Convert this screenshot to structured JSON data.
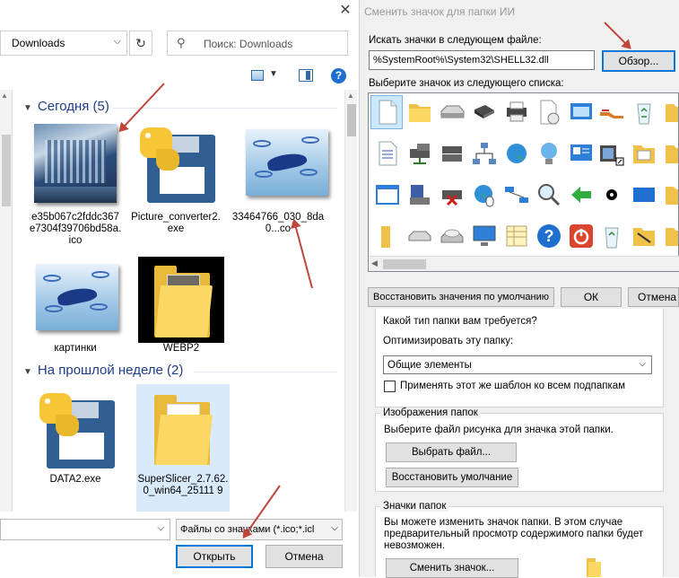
{
  "file_dialog": {
    "address": "Downloads",
    "search_placeholder": "Поиск: Downloads",
    "groups": [
      {
        "label": "Сегодня (5)"
      },
      {
        "label": "На прошлой неделе (2)"
      }
    ],
    "files": [
      {
        "name": "e35b067c2fddc367e7304f39706bd58a.ico"
      },
      {
        "name": "Picture_converter2.exe"
      },
      {
        "name": "33464766_030_8da0...co"
      },
      {
        "name": "картинки"
      },
      {
        "name": "WEBP2"
      },
      {
        "name": "DATA2.exe"
      },
      {
        "name": "SuperSlicer_2.7.62.0_win64_25111 9"
      }
    ],
    "filter": "Файлы со значками (*.ico;*.icl",
    "open_label": "Открыть",
    "cancel_label": "Отмена"
  },
  "icon_dialog": {
    "title": "Сменить значок для папки ИИ",
    "search_label": "Искать значки в следующем файле:",
    "path": "%SystemRoot%\\System32\\SHELL32.dll",
    "browse_label": "Обзор...",
    "list_label": "Выберите значок из следующего списка:",
    "restore_defaults_label": "Восстановить значения по умолчанию",
    "ok_label": "ОК",
    "cancel_label": "Отмена"
  },
  "properties": {
    "folder_type_question": "Какой тип папки вам требуется?",
    "optimize_label": "Оптимизировать эту папку:",
    "optimize_value": "Общие элементы",
    "apply_subfolders_label": "Применять этот же шаблон ко всем подпапкам",
    "folder_images_legend": "Изображения папок",
    "folder_images_text": "Выберите файл рисунка для значка этой папки.",
    "choose_file_label": "Выбрать файл...",
    "restore_default_label": "Восстановить умолчание",
    "folder_icons_legend": "Значки папок",
    "folder_icons_text1": "Вы можете изменить значок папки. В этом случае",
    "folder_icons_text2": "предварительный просмотр содержимого папки будет",
    "folder_icons_text3": "невозможен.",
    "change_icon_label": "Сменить значок..."
  },
  "colors": {
    "accent": "#0078d7",
    "group_header": "#1e3f8a",
    "annotation_arrow": "#c0453b",
    "selection": "#cce8ff"
  }
}
